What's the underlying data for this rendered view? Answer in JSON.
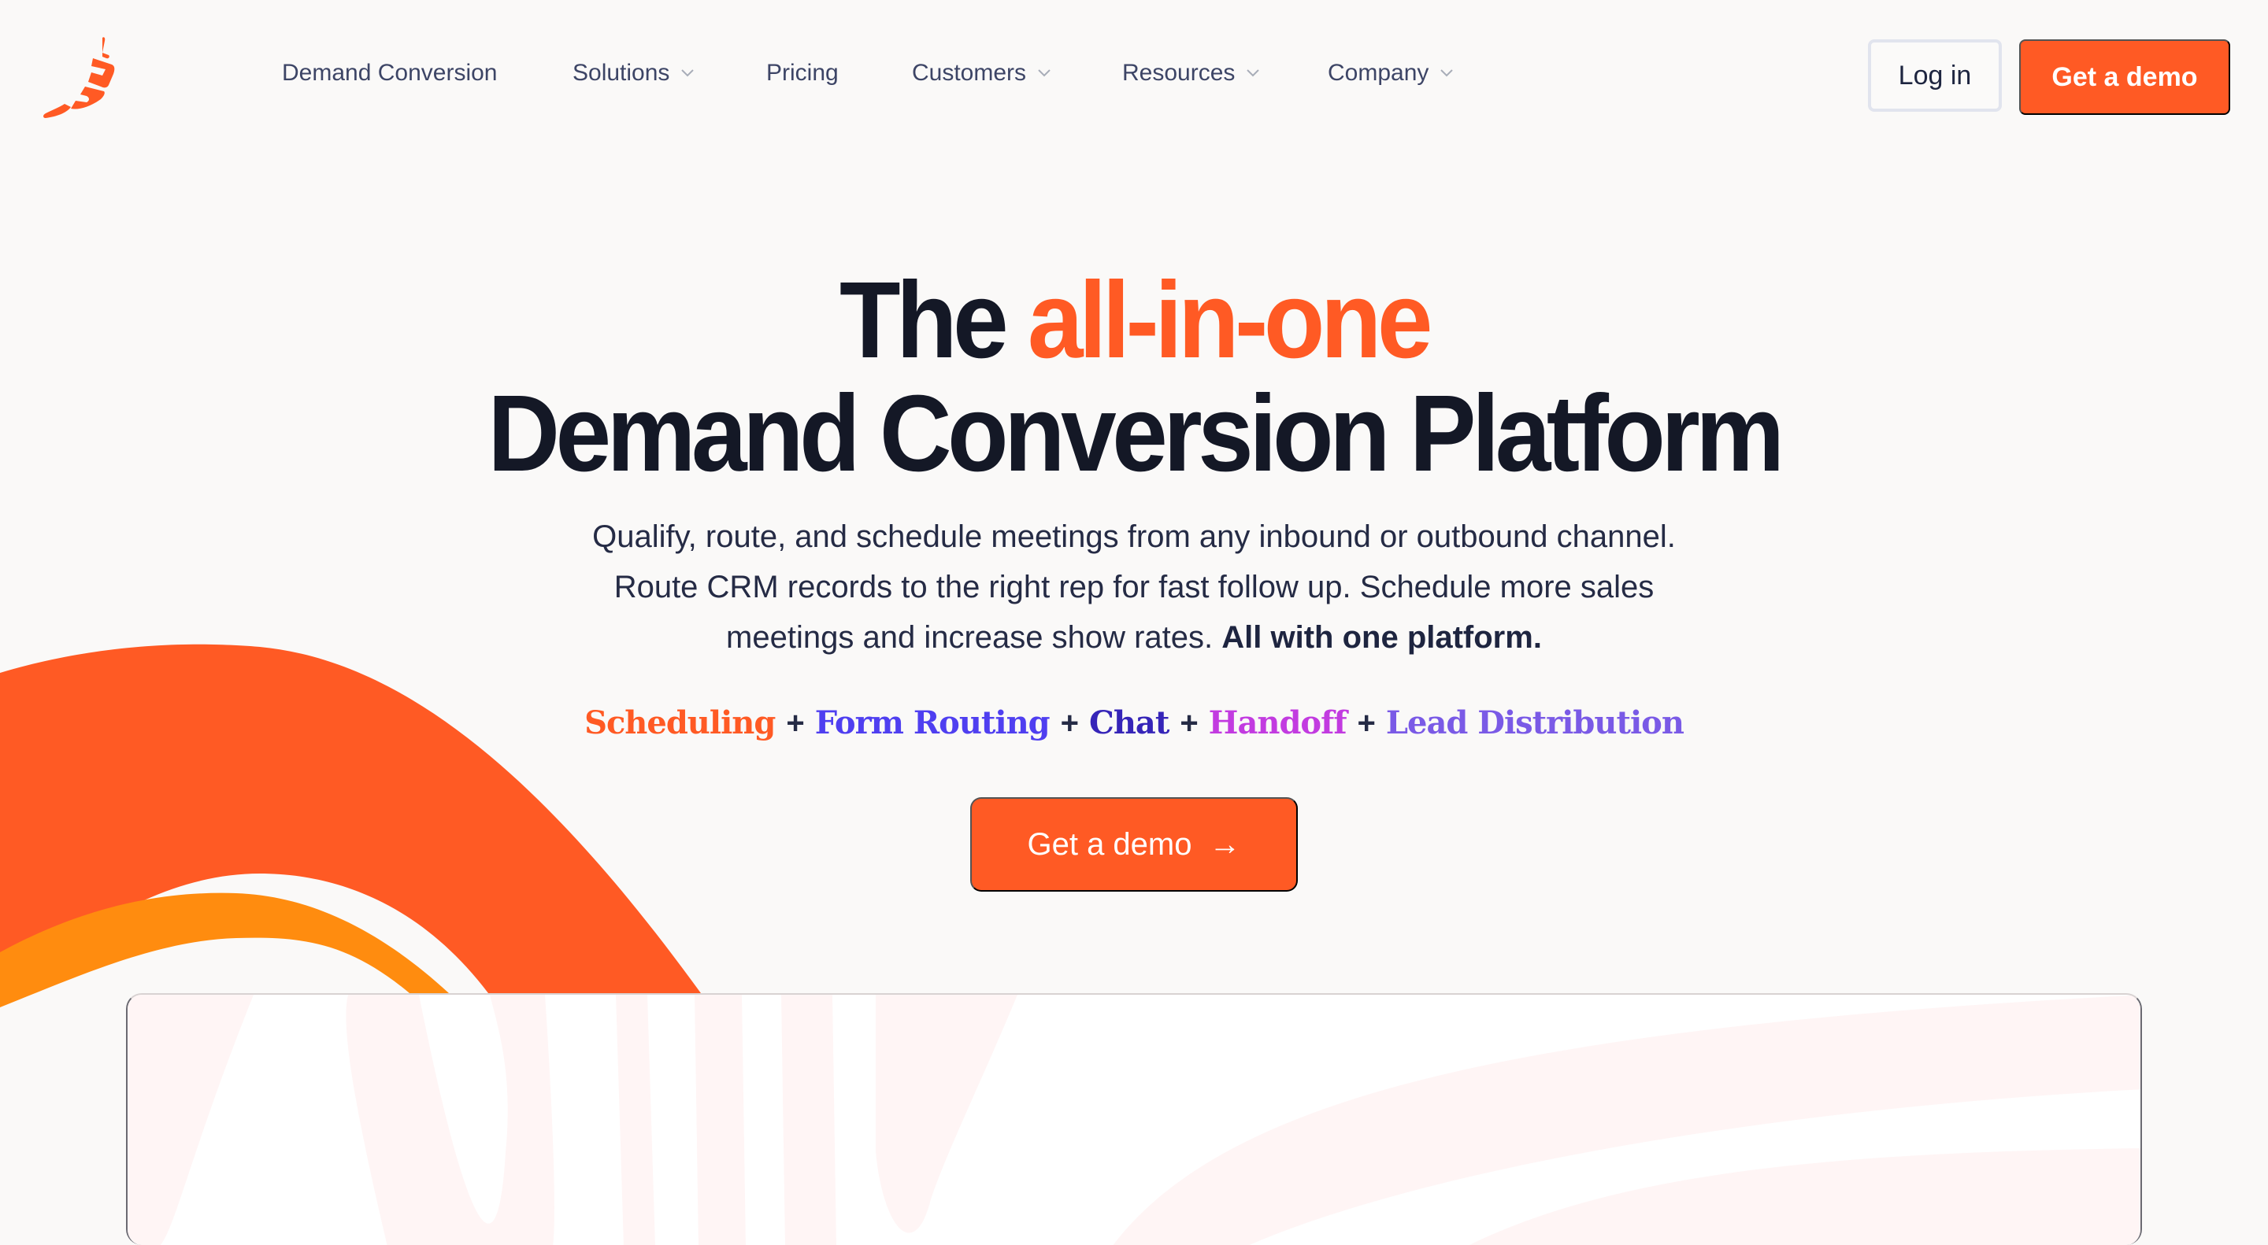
{
  "brand": {
    "logo_icon": "chili-pepper-logo-icon",
    "accent_color": "#ff5a24",
    "secondary_color": "#ff8c0f"
  },
  "nav": {
    "items": [
      {
        "label": "Demand Conversion",
        "has_dropdown": false
      },
      {
        "label": "Solutions",
        "has_dropdown": true
      },
      {
        "label": "Pricing",
        "has_dropdown": false
      },
      {
        "label": "Customers",
        "has_dropdown": true
      },
      {
        "label": "Resources",
        "has_dropdown": true
      },
      {
        "label": "Company",
        "has_dropdown": true
      }
    ],
    "login_label": "Log in",
    "demo_label": "Get a demo"
  },
  "hero": {
    "title_prefix": "The ",
    "title_accent": "all-in-one",
    "title_line2": "Demand Conversion Platform",
    "subtitle_line1": "Qualify, route, and schedule meetings from any inbound or outbound channel.",
    "subtitle_line2": "Route CRM records to the right rep for fast follow up. Schedule more sales",
    "subtitle_line3": "meetings and increase show rates. ",
    "subtitle_bold": "All with one platform.",
    "features": [
      {
        "label": "Scheduling",
        "color": "#ff5a24"
      },
      {
        "label": "Form Routing",
        "color": "#4f3ff0"
      },
      {
        "label": "Chat",
        "color": "#3625b8"
      },
      {
        "label": "Handoff",
        "color": "#c23be0"
      },
      {
        "label": "Lead Distribution",
        "color": "#7a5ae6"
      }
    ],
    "separator": "+",
    "cta_label": "Get a demo",
    "cta_icon": "arrow-right-icon"
  }
}
